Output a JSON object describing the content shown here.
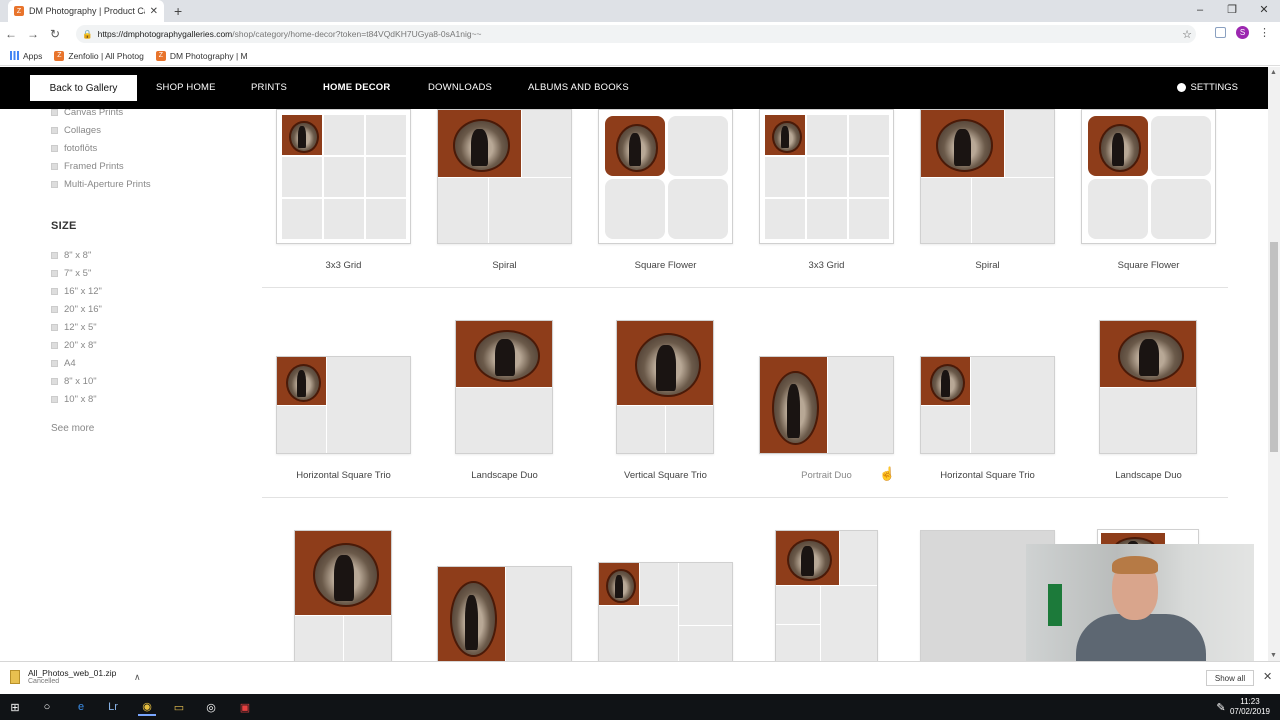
{
  "browser": {
    "tab_title": "DM Photography | Product Catego",
    "tab_favicon": "Z",
    "new_tab": "+",
    "url_host": "https://dmphotographygalleries.com",
    "url_path": "/shop/category/home-decor?token=t84VQdKH7UGya8-0sA1nig~~",
    "profile_initial": "S",
    "bookmarks": [
      "Apps",
      "Zenfolio | All Photog",
      "DM Photography | M"
    ]
  },
  "sitenav": {
    "back_label": "Back to Gallery",
    "items": [
      "SHOP HOME",
      "PRINTS",
      "HOME DECOR",
      "DOWNLOADS",
      "ALBUMS AND BOOKS"
    ],
    "settings_label": "SETTINGS"
  },
  "filters": {
    "type_items": [
      "Canvas Prints",
      "Collages",
      "fotoflōts",
      "Framed Prints",
      "Multi-Aperture Prints"
    ],
    "size_heading": "SIZE",
    "size_items": [
      "8\" x 8\"",
      "7\" x 5\"",
      "16\" x 12\"",
      "20\" x 16\"",
      "12\" x 5\"",
      "20\" x 8\"",
      "A4",
      "8\" x 10\"",
      "10\" x 8\""
    ],
    "see_more": "See more"
  },
  "products": {
    "row1": [
      "3x3 Grid",
      "Spiral",
      "Square Flower",
      "3x3 Grid",
      "Spiral",
      "Square Flower"
    ],
    "row2": [
      "Horizontal Square Trio",
      "Landscape Duo",
      "Vertical Square Trio",
      "Portrait Duo",
      "Horizontal Square Trio",
      "Landscape Duo"
    ]
  },
  "download": {
    "filename": "All_Photos_web_01.zip",
    "status": "Cancelled",
    "show_all": "Show all"
  },
  "clock": {
    "time": "11:23",
    "date": "07/02/2019"
  }
}
